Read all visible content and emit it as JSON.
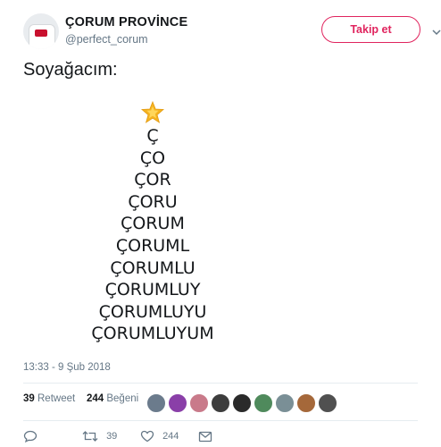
{
  "user": {
    "display_name": "ÇORUM PROVİNCE",
    "handle": "@perfect_corum"
  },
  "follow_label": "Takip et",
  "tweet": {
    "text": "Soyağacım:",
    "tree_lines": [
      "Ç",
      "ÇO",
      "ÇOR",
      "ÇORU",
      "ÇORUM",
      "ÇORUML",
      "ÇORUMLU",
      "ÇORUMLUY",
      "ÇORUMLUYU",
      "ÇORUMLUYUM"
    ],
    "star_emoji": "star-emoji"
  },
  "timestamp": "13:33 - 9 Şub 2018",
  "stats": {
    "retweets_count": "39",
    "retweets_label": "Retweet",
    "likes_count": "244",
    "likes_label": "Beğeni"
  },
  "likers": [
    {
      "color": "#6b7b8c"
    },
    {
      "color": "#8a3fa8"
    },
    {
      "color": "#c97a8a"
    },
    {
      "color": "#3d3d3d"
    },
    {
      "color": "#2a2a2a"
    },
    {
      "color": "#4f8a5c"
    },
    {
      "color": "#7a8f96"
    },
    {
      "color": "#a5683a"
    },
    {
      "color": "#505050"
    }
  ],
  "actions": {
    "reply_icon": "reply-icon",
    "retweet_count": "39",
    "like_count": "244",
    "dm_icon": "envelope-icon"
  },
  "colors": {
    "accent": "#e0245e",
    "muted": "#657786",
    "text": "#14171a"
  }
}
